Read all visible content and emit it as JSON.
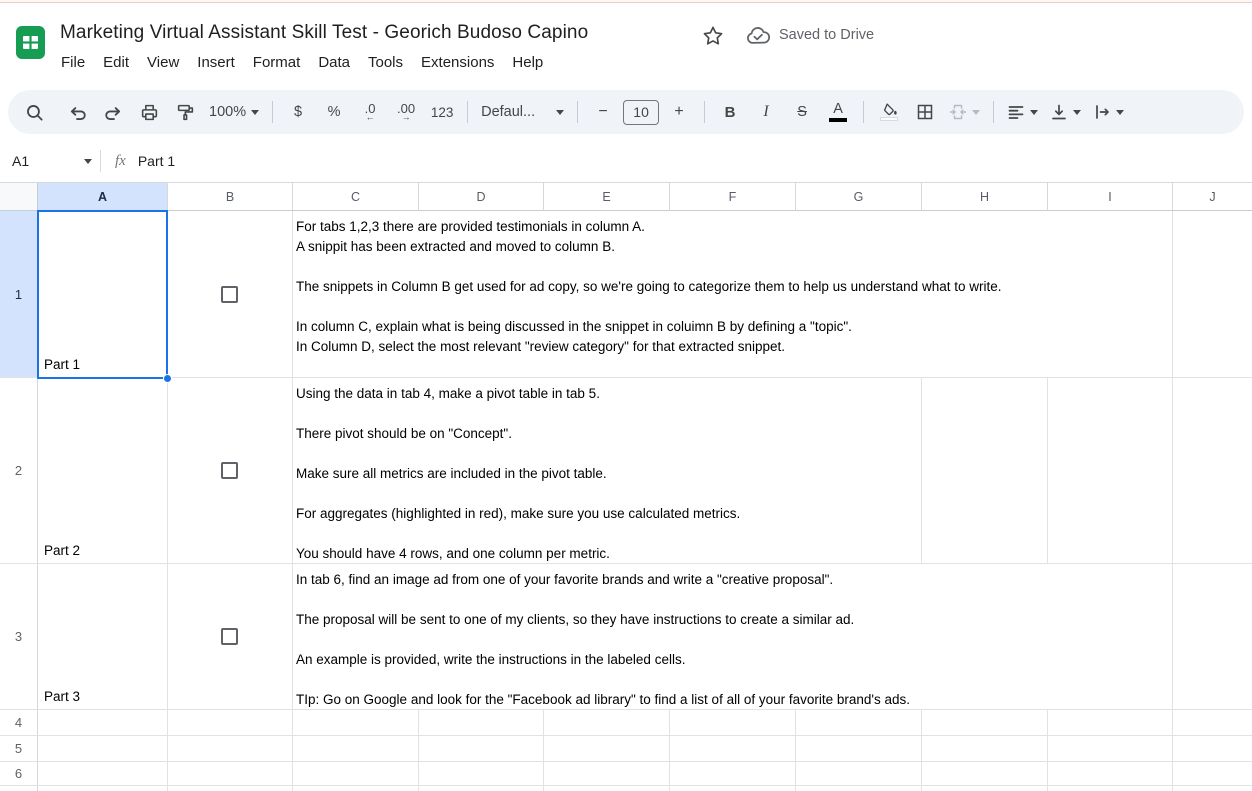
{
  "header": {
    "title": "Marketing Virtual Assistant Skill Test - Georich Budoso Capino",
    "saved_label": "Saved to Drive"
  },
  "menubar": {
    "items": [
      "File",
      "Edit",
      "View",
      "Insert",
      "Format",
      "Data",
      "Tools",
      "Extensions",
      "Help"
    ]
  },
  "toolbar": {
    "zoom": "100%",
    "currency": "$",
    "percent": "%",
    "decimal_decrease": ".0",
    "decimal_increase": ".00",
    "more_formats": "123",
    "font_name": "Defaul...",
    "minus": "−",
    "font_size": "10",
    "plus": "+",
    "bold": "B",
    "italic": "I",
    "strikethrough": "S",
    "text_color": "A"
  },
  "formula_bar": {
    "name_box": "A1",
    "fx_label": "fx",
    "content": "Part 1"
  },
  "grid": {
    "columns": [
      "A",
      "B",
      "C",
      "D",
      "E",
      "F",
      "G",
      "H",
      "I",
      "J"
    ],
    "row_numbers": [
      "1",
      "2",
      "3",
      "4",
      "5",
      "6"
    ],
    "checkboxes": {
      "B1": false,
      "B2": false,
      "B3": false
    },
    "cells": {
      "A1": "Part 1",
      "A2": "Part 2",
      "A3": "Part 3",
      "C1": "For tabs 1,2,3 there are provided testimonials in column A.\nA snippit has been extracted and moved to column B.\n\nThe snippets in Column B get used for ad copy, so we're going to categorize them to help us understand what to write.\n\nIn column C, explain what is being discussed in the snippet in coluimn B by defining a \"topic\".\nIn Column D, select the most relevant \"review category\" for that extracted snippet.",
      "C2": "Using the data in tab 4, make a pivot table in tab 5.\n\nThere pivot should be on \"Concept\".\n\nMake sure all metrics are included in the pivot table.\n\nFor aggregates (highlighted in red), make sure you use calculated metrics.\n\nYou should have 4 rows, and one column per metric.",
      "C3": "In tab 6, find an image ad from one of your favorite brands and write a \"creative proposal\".\n\nThe proposal will be sent to one of my clients, so they have instructions to create a similar ad.\n\nAn example is provided, write the instructions in the labeled cells.\n\nTIp: Go on Google and look for the \"Facebook ad library\" to find a list of all of your favorite brand's ads."
    }
  },
  "colors": {
    "accent_blue": "#1a73e8",
    "selected_header_bg": "#d3e3fd",
    "toolbar_bg": "#f0f4f9",
    "logo_green": "#169c53",
    "icon_gray": "#444746",
    "muted_text": "#5f6368",
    "gridline": "#e2e2e2"
  }
}
